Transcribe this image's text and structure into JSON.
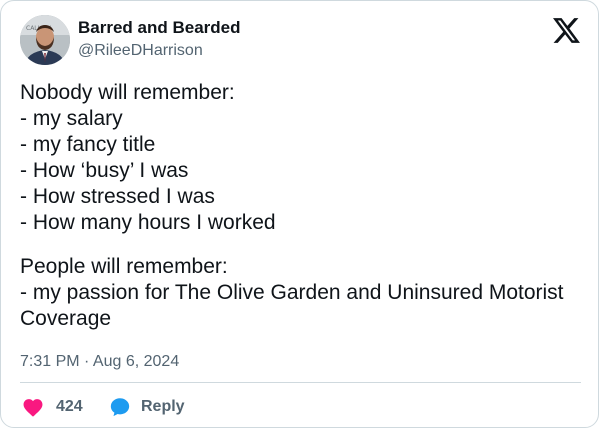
{
  "author": {
    "name": "Barred and Bearded",
    "handle": "@RileeDHarrison",
    "avatar_icon": "profile-photo"
  },
  "platform": {
    "logo_icon": "x-logo-icon"
  },
  "tweet": {
    "lines": [
      "Nobody will remember:",
      "- my salary",
      "- my fancy title",
      "- How ‘busy’ I was",
      "- How stressed I was",
      "- How many hours I worked",
      "",
      "People will remember:",
      "- my passion for The Olive Garden and Uninsured Motorist Coverage"
    ],
    "timestamp": "7:31 PM · Aug 6, 2024"
  },
  "actions": {
    "like": {
      "icon": "heart-icon",
      "count": "424",
      "color": "#f91880"
    },
    "reply": {
      "icon": "speech-bubble-icon",
      "label": "Reply",
      "color": "#1d9bf0"
    }
  }
}
